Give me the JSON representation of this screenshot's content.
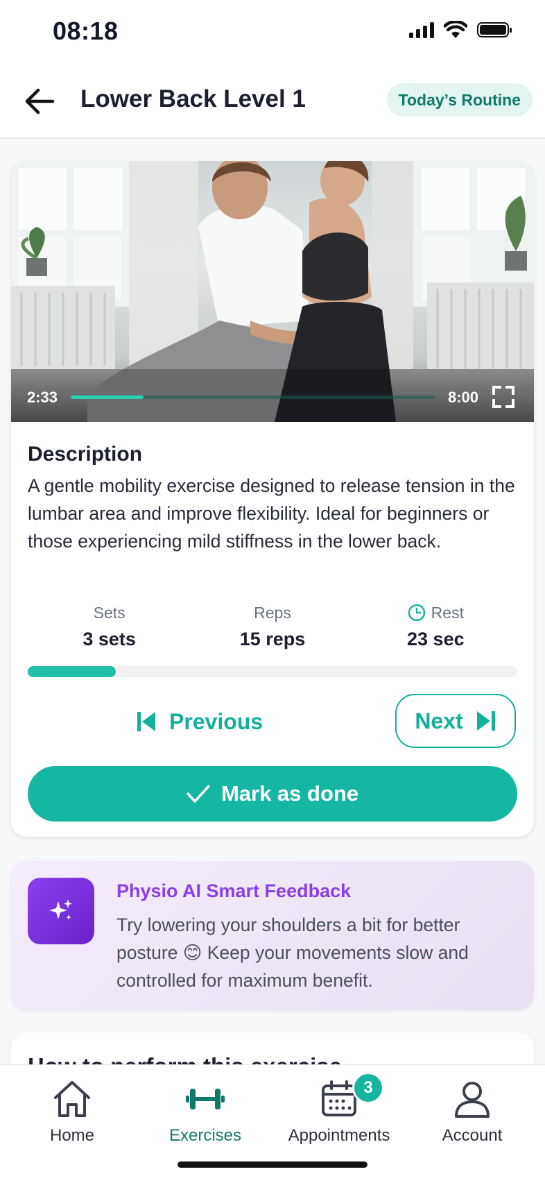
{
  "status_bar": {
    "time": "08:18"
  },
  "header": {
    "title": "Lower Back Level 1",
    "routine_chip": "Today’s Routine"
  },
  "video": {
    "current_time": "2:33",
    "duration": "8:00",
    "progress_fraction": 0.2
  },
  "description": {
    "heading": "Description",
    "text": "A gentle mobility exercise designed to release tension in the lumbar area and improve flexibility. Ideal for beginners or those experiencing mild stiffness in the lower back."
  },
  "stats": {
    "sets": {
      "label": "Sets",
      "value": "3 sets"
    },
    "reps": {
      "label": "Reps",
      "value": "15 reps"
    },
    "rest": {
      "label": "Rest",
      "value": "23 sec"
    }
  },
  "exercise_progress_fraction": 0.18,
  "controls": {
    "previous_label": "Previous",
    "next_label": "Next",
    "done_label": "Mark as done"
  },
  "ai_feedback": {
    "title": "Physio AI Smart Feedback",
    "text": "Try lowering your shoulders a bit for better posture 😊 Keep your movements slow and controlled for maximum benefit."
  },
  "how_to": {
    "title": "How to perform this exercise"
  },
  "nav": {
    "home": "Home",
    "exercises": "Exercises",
    "appointments": "Appointments",
    "appointments_badge": "3",
    "account": "Account"
  },
  "colors": {
    "accent": "#16b7a2",
    "dark_teal": "#0f7a6a",
    "ai_purple": "#8a3fe6"
  }
}
